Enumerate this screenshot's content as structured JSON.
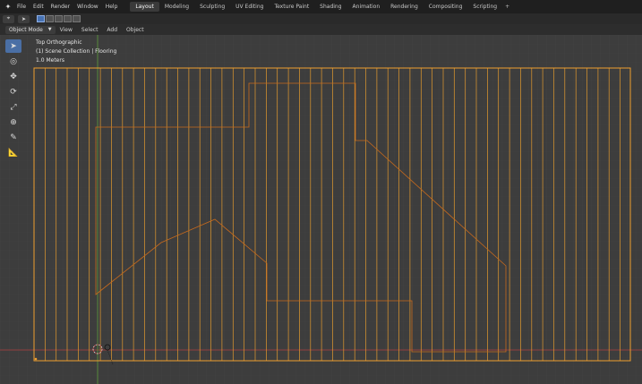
{
  "menu": [
    "File",
    "Edit",
    "Render",
    "Window",
    "Help"
  ],
  "workspaces": [
    "Layout",
    "Modeling",
    "Sculpting",
    "UV Editing",
    "Texture Paint",
    "Shading",
    "Animation",
    "Rendering",
    "Compositing",
    "Scripting"
  ],
  "workspace_add": "+",
  "header": {
    "mode": "Object Mode",
    "menus": [
      "View",
      "Select",
      "Add",
      "Object"
    ]
  },
  "overlay": {
    "view": "Top Orthographic",
    "collection": "(1) Scene Collection | Flooring",
    "scale": "1.0 Meters"
  },
  "colors": {
    "background": "#3d3d3d",
    "selection": "#f0a030",
    "inner_outline": "#c86a1c",
    "x_axis": "#b04040",
    "y_axis": "#5f9e3a",
    "active_tab": "#3a3a3a",
    "active_tool": "#4a6fa5"
  },
  "icons": {
    "logo": "blender-logo-icon",
    "tools": [
      "select-box-icon",
      "cursor-icon",
      "move-icon",
      "rotate-icon",
      "scale-icon",
      "transform-icon",
      "annotate-icon",
      "measure-icon"
    ]
  }
}
